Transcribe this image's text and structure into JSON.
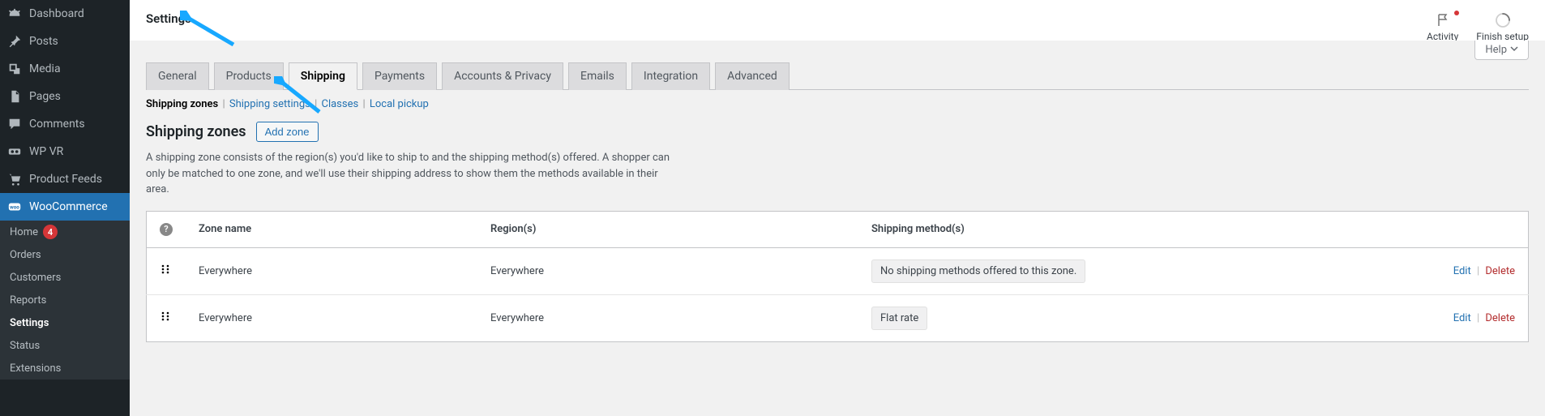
{
  "sidebar": {
    "items": [
      {
        "label": "Dashboard",
        "icon": "dashboard"
      },
      {
        "label": "Posts",
        "icon": "pin"
      },
      {
        "label": "Media",
        "icon": "media"
      },
      {
        "label": "Pages",
        "icon": "pages"
      },
      {
        "label": "Comments",
        "icon": "comment"
      },
      {
        "label": "WP VR",
        "icon": "wpvr"
      },
      {
        "label": "Product Feeds",
        "icon": "cart"
      }
    ],
    "current": {
      "label": "WooCommerce",
      "icon": "woo"
    },
    "sub": [
      {
        "label": "Home",
        "badge": "4"
      },
      {
        "label": "Orders"
      },
      {
        "label": "Customers"
      },
      {
        "label": "Reports"
      },
      {
        "label": "Settings",
        "active": true
      },
      {
        "label": "Status"
      },
      {
        "label": "Extensions"
      }
    ]
  },
  "topbar": {
    "title": "Settings",
    "activity": "Activity",
    "finish": "Finish setup"
  },
  "help": {
    "label": "Help"
  },
  "tabs": [
    "General",
    "Products",
    "Shipping",
    "Payments",
    "Accounts & Privacy",
    "Emails",
    "Integration",
    "Advanced"
  ],
  "tabs_active_index": 2,
  "subnav": [
    {
      "label": "Shipping zones",
      "current": true
    },
    {
      "label": "Shipping settings"
    },
    {
      "label": "Classes"
    },
    {
      "label": "Local pickup"
    }
  ],
  "section": {
    "heading": "Shipping zones",
    "add_button": "Add zone",
    "description": "A shipping zone consists of the region(s) you'd like to ship to and the shipping method(s) offered. A shopper can only be matched to one zone, and we'll use their shipping address to show them the methods available in their area."
  },
  "table": {
    "headers": {
      "zone": "Zone name",
      "region": "Region(s)",
      "method": "Shipping method(s)"
    },
    "rows": [
      {
        "zone": "Everywhere",
        "region": "Everywhere",
        "method": "No shipping methods offered to this zone.",
        "method_style": "badge"
      },
      {
        "zone": "Everywhere",
        "region": "Everywhere",
        "method": "Flat rate",
        "method_style": "badge"
      }
    ],
    "actions": {
      "edit": "Edit",
      "delete": "Delete"
    }
  }
}
